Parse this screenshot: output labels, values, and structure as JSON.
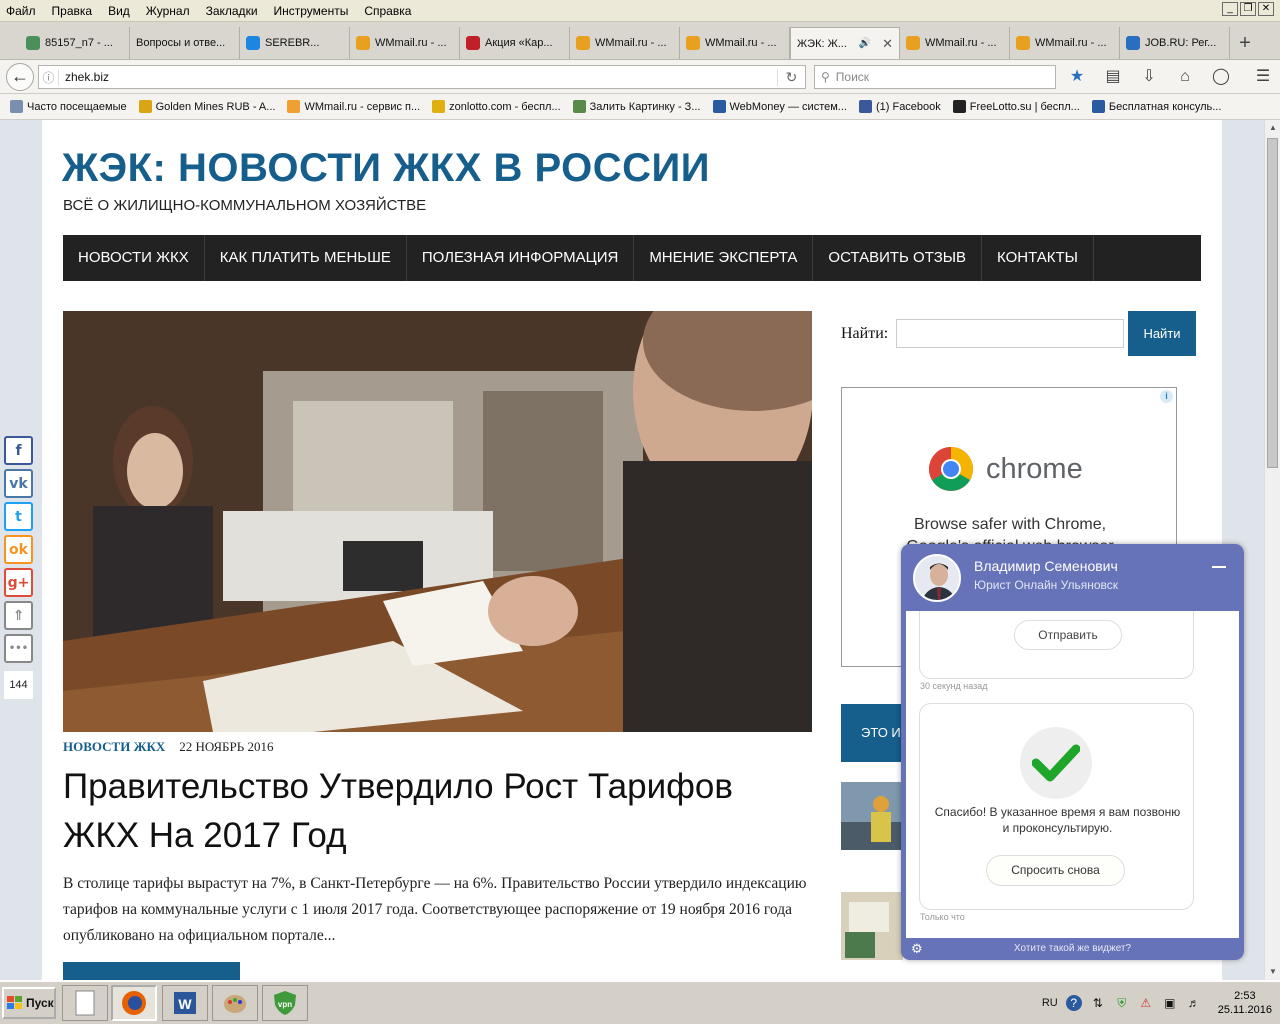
{
  "menu": [
    "Файл",
    "Правка",
    "Вид",
    "Журнал",
    "Закладки",
    "Инструменты",
    "Справка"
  ],
  "window_buttons": [
    "_",
    "❐",
    "✕"
  ],
  "tabs": [
    {
      "label": "85157_n7 - ...",
      "color": "#4b8f5a"
    },
    {
      "label": "Вопросы и отве...",
      "color": ""
    },
    {
      "label": "SEREBR...",
      "color": "#1d86e0"
    },
    {
      "label": "WMmail.ru - ...",
      "color": "#e8a020"
    },
    {
      "label": "Акция «Кар...",
      "color": "#c0202a"
    },
    {
      "label": "WMmail.ru - ...",
      "color": "#e8a020"
    },
    {
      "label": "WMmail.ru - ...",
      "color": "#e8a020"
    },
    {
      "label": "ЖЭК: Ж...",
      "color": "",
      "active": true
    },
    {
      "label": "WMmail.ru - ...",
      "color": "#e8a020"
    },
    {
      "label": "WMmail.ru - ...",
      "color": "#e8a020"
    },
    {
      "label": "JOB.RU: Рег...",
      "color": "#2a6fbf"
    }
  ],
  "url": "zhek.biz",
  "search_placeholder": "Поиск",
  "bookmarks": [
    {
      "label": "Часто посещаемые",
      "color": "#7a8fb0"
    },
    {
      "label": "Golden Mines RUB - A...",
      "color": "#d9a514"
    },
    {
      "label": "WMmail.ru - сервис п...",
      "color": "#f0a030"
    },
    {
      "label": "zonlotto.com - беспл...",
      "color": "#e0b010"
    },
    {
      "label": "Залить Картинку - З...",
      "color": "#5a8a4a"
    },
    {
      "label": "WebMoney — систем...",
      "color": "#2a5aa0"
    },
    {
      "label": "(1) Facebook",
      "color": "#3b5998"
    },
    {
      "label": "FreeLotto.su | беспл...",
      "color": "#222222"
    },
    {
      "label": "Бесплатная консуль...",
      "color": "#2a5aa0"
    }
  ],
  "site": {
    "title": "ЖЭК: НОВОСТИ ЖКХ В РОССИИ",
    "description": "ВСЁ О ЖИЛИЩНО-КОММУНАЛЬНОМ ХОЗЯЙСТВЕ",
    "nav": [
      "НОВОСТИ ЖКХ",
      "КАК ПЛАТИТЬ МЕНЬШЕ",
      "ПОЛЕЗНАЯ ИНФОРМАЦИЯ",
      "МНЕНИЕ ЭКСПЕРТА",
      "ОСТАВИТЬ ОТЗЫВ",
      "КОНТАКТЫ"
    ],
    "accent": "#165e8c"
  },
  "post": {
    "category": "НОВОСТИ ЖКХ",
    "date": "22 НОЯБРЬ 2016",
    "title": "Правительство Утвердило Рост Тарифов ЖКХ На 2017 Год",
    "excerpt": "В столице тарифы вырастут на 7%, в Санкт-Петербурге — на 6%. Правительство России утвердило индексацию тарифов на коммунальные услуги с 1 июля 2017 года. Соответствующее распоряжение от 19 ноября 2016 года опубликовано на официальном портале..."
  },
  "sidebar": {
    "search_label": "Найти:",
    "search_button": "Найти",
    "ad_brand": "chrome",
    "ad_text_1": "Browse safer with Chrome,",
    "ad_text_2": "Google's official web browser",
    "box_label": "ЭТО И"
  },
  "share": {
    "buttons": [
      {
        "name": "facebook",
        "glyph": "f",
        "color": "#3b5998"
      },
      {
        "name": "vkontakte",
        "glyph": "vk",
        "color": "#4a76a8"
      },
      {
        "name": "twitter",
        "glyph": "t",
        "color": "#1da1f2"
      },
      {
        "name": "odnoklassniki",
        "glyph": "ok",
        "color": "#f7931e"
      },
      {
        "name": "googleplus",
        "glyph": "g+",
        "color": "#dd4b39"
      },
      {
        "name": "scroll-up",
        "glyph": "⇑",
        "color": "#888888"
      },
      {
        "name": "more",
        "glyph": "•••",
        "color": "#888888"
      }
    ],
    "count": "144"
  },
  "chat": {
    "name": "Владимир Семенович",
    "role": "Юрист Онлайн Ульяновск",
    "send_button": "Отправить",
    "ts1": "30 секунд назад",
    "thanks": "Спасибо! В указанное время я вам позвоню и проконсультирую.",
    "ask_again": "Спросить снова",
    "ts2": "Только что",
    "footer_link": "Хотите такой же виджет?",
    "color": "#6673b8"
  },
  "taskbar": {
    "start": "Пуск",
    "lang": "RU",
    "time": "2:53",
    "date": "25.11.2016"
  }
}
